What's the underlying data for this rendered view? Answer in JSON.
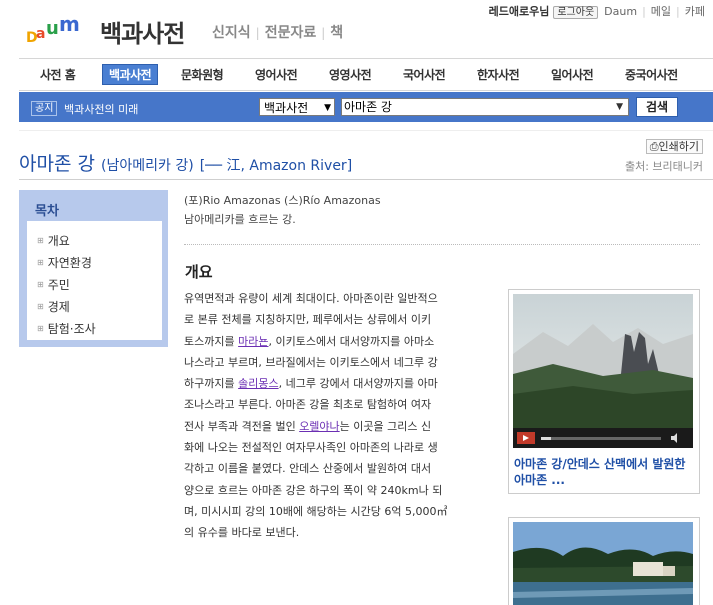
{
  "header": {
    "logo": "Daum",
    "title": "백과사전",
    "subnav": [
      "신지식",
      "전문자료",
      "책"
    ],
    "user": "레드애로우님",
    "logout": "로그아웃",
    "links": [
      "Daum",
      "메일",
      "카페"
    ]
  },
  "tabs": [
    "사전 홈",
    "백과사전",
    "문화원형",
    "영어사전",
    "영영사전",
    "국어사전",
    "한자사전",
    "일어사전",
    "중국어사전"
  ],
  "searchbar": {
    "notice_badge": "공지",
    "notice_text": "백과사전의 미래",
    "category": "백과사전",
    "query": "아마존 강",
    "button": "검색"
  },
  "article": {
    "title": "아마존 강",
    "title_sub": "(남아메리카 강)",
    "title_hanja": "[── 江, Amazon River]",
    "print": "인쇄하기",
    "source": "출처: 브리태니커",
    "aka": "(포)Rio Amazonas (스)Río Amazonas",
    "desc": "남아메리카를 흐르는 강.",
    "section": "개요",
    "paragraph": [
      [
        "유역면적과 유량이 세계 최대이다. 아마존이란 일반적으"
      ],
      [
        "로 본류 전체를 지칭하지만, 페루에서는 상류에서 이키"
      ],
      [
        "토스까지를 ",
        {
          "link": "마라뇬"
        },
        ", 이키토스에서 대서양까지를 아마소"
      ],
      [
        "나스라고 부르며, 브라질에서는 이키토스에서 네그루 강"
      ],
      [
        "하구까지를 ",
        {
          "link": "솔리몽스"
        },
        ", 네그루 강에서 대서양까지를 아마"
      ],
      [
        "조나스라고 부른다. 아마존 강을 최초로 탐험하여 여자"
      ],
      [
        "전사 부족과 격전을 벌인 ",
        {
          "link": "오렐야나"
        },
        "는 이곳을 그리스 신"
      ],
      [
        "화에 나오는 전설적인 여자무사족인 아마존의 나라로 생"
      ],
      [
        "각하고 이름을 붙였다. 안데스 산중에서 발원하여 대서"
      ],
      [
        "양으로 흐르는 아마존 강은 하구의 폭이 약 240km나 되"
      ],
      [
        "며, 미시시피 강의 10배에 해당하는 시간당 6억 5,000㎥"
      ],
      [
        "의 유수를 바다로 보낸다."
      ]
    ]
  },
  "toc": {
    "title": "목차",
    "items": [
      "개요",
      "자연환경",
      "주민",
      "경제",
      "탐험·조사"
    ]
  },
  "media": {
    "video_caption": "아마존 강/안데스 산맥에서 발원한 아마존 ..."
  },
  "colors": {
    "accent": "#4676c9",
    "title_blue": "#1f4fa6",
    "toc_bg": "#b7c9ec",
    "link": "#6b2fb3"
  }
}
